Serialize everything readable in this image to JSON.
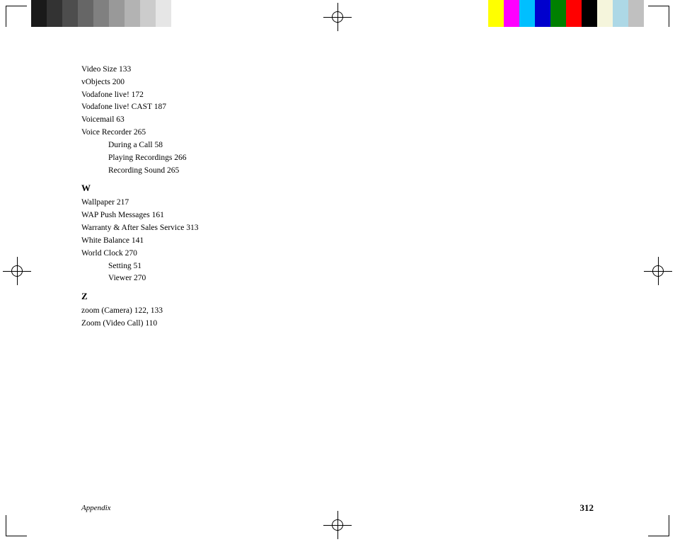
{
  "colorBarsLeft": [
    {
      "color": "#1a1a1a"
    },
    {
      "color": "#333333"
    },
    {
      "color": "#4d4d4d"
    },
    {
      "color": "#666666"
    },
    {
      "color": "#808080"
    },
    {
      "color": "#999999"
    },
    {
      "color": "#b3b3b3"
    },
    {
      "color": "#cccccc"
    },
    {
      "color": "#e6e6e6"
    },
    {
      "color": "#ffffff"
    }
  ],
  "colorBarsRight": [
    {
      "color": "#ffff00"
    },
    {
      "color": "#ff00ff"
    },
    {
      "color": "#00bfff"
    },
    {
      "color": "#0000cd"
    },
    {
      "color": "#008000"
    },
    {
      "color": "#ff0000"
    },
    {
      "color": "#000000"
    },
    {
      "color": "#f5f5dc"
    },
    {
      "color": "#add8e6"
    },
    {
      "color": "#c0c0c0"
    }
  ],
  "sections": {
    "v_items": [
      {
        "text": "Video Size  133",
        "indented": false
      },
      {
        "text": "vObjects  200",
        "indented": false
      },
      {
        "text": "Vodafone live!  172",
        "indented": false
      },
      {
        "text": "Vodafone live! CAST  187",
        "indented": false
      },
      {
        "text": "Voicemail  63",
        "indented": false
      },
      {
        "text": "Voice Recorder  265",
        "indented": false
      },
      {
        "text": "During a Call  58",
        "indented": true
      },
      {
        "text": "Playing Recordings  266",
        "indented": true
      },
      {
        "text": "Recording Sound  265",
        "indented": true
      }
    ],
    "w_letter": "W",
    "w_items": [
      {
        "text": "Wallpaper  217",
        "indented": false
      },
      {
        "text": "WAP Push Messages  161",
        "indented": false
      },
      {
        "text": "Warranty & After Sales Service  313",
        "indented": false
      },
      {
        "text": "White Balance  141",
        "indented": false
      },
      {
        "text": "World Clock  270",
        "indented": false
      },
      {
        "text": "Setting  51",
        "indented": true
      },
      {
        "text": "Viewer  270",
        "indented": true
      }
    ],
    "z_letter": "Z",
    "z_items": [
      {
        "text": "zoom (Camera)  122, 133",
        "indented": false
      },
      {
        "text": "Zoom (Video Call)  110",
        "indented": false
      }
    ]
  },
  "footer": {
    "left_text": "Appendix",
    "right_text": "312"
  }
}
